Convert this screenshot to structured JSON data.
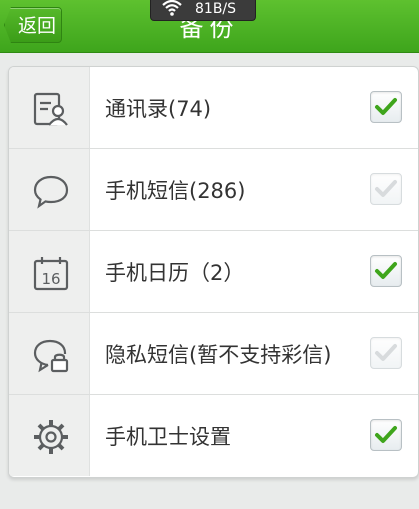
{
  "header": {
    "back_label": "返回",
    "title": "备份",
    "status_speed": "81B/S",
    "color": "#4ab324"
  },
  "items": [
    {
      "label": "通讯录(74)",
      "icon": "contacts-icon",
      "checked": true,
      "enabled": true
    },
    {
      "label": "手机短信(286)",
      "icon": "sms-bubble-icon",
      "checked": true,
      "enabled": false
    },
    {
      "label": "手机日历（2）",
      "icon": "calendar-icon",
      "icon_text": "16",
      "checked": true,
      "enabled": true
    },
    {
      "label": "隐私短信(暂不支持彩信)",
      "icon": "private-sms-lock-icon",
      "checked": true,
      "enabled": false
    },
    {
      "label": "手机卫士设置",
      "icon": "gear-icon",
      "checked": true,
      "enabled": true
    }
  ],
  "colors": {
    "check_green": "#3fa51c",
    "check_disabled": "#b9bfc2"
  }
}
